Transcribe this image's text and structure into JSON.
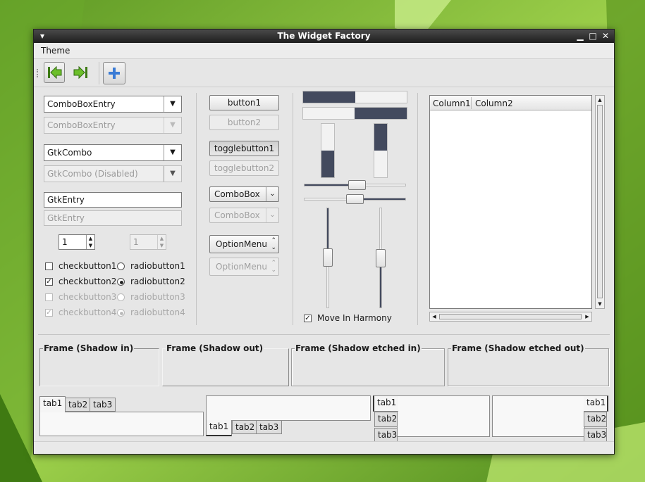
{
  "window": {
    "title": "The Widget Factory"
  },
  "menubar": {
    "theme": "Theme"
  },
  "left": {
    "combo_entry": "ComboBoxEntry",
    "combo_entry_dis": "ComboBoxEntry",
    "gtkcombo": "GtkCombo",
    "gtkcombo_dis": "GtkCombo (Disabled)",
    "entry": "GtkEntry",
    "entry_dis": "GtkEntry",
    "spin": "1",
    "spin_dis": "1",
    "check1": "checkbutton1",
    "check2": "checkbutton2",
    "check3": "checkbutton3",
    "check4": "checkbutton4",
    "radio1": "radiobutton1",
    "radio2": "radiobutton2",
    "radio3": "radiobutton3",
    "radio4": "radiobutton4"
  },
  "buttons": {
    "button1": "button1",
    "button2": "button2",
    "toggle1": "togglebutton1",
    "toggle2": "togglebutton2",
    "combobox": "ComboBox",
    "combobox_dis": "ComboBox",
    "optionmenu": "OptionMenu",
    "optionmenu_dis": "OptionMenu"
  },
  "sliders": {
    "harmony": "Move In Harmony"
  },
  "tree": {
    "columns": [
      "Column1",
      "Column2"
    ]
  },
  "frames": {
    "shadow_in": "Frame (Shadow in)",
    "shadow_out": "Frame (Shadow out)",
    "etched_in": "Frame (Shadow etched in)",
    "etched_out": "Frame (Shadow etched out)"
  },
  "tabs": {
    "t1": "tab1",
    "t2": "tab2",
    "t3": "tab3"
  },
  "icons": [
    "back-icon",
    "forward-icon",
    "add-icon",
    "minimize-icon",
    "maximize-icon",
    "close-icon",
    "window-menu-icon"
  ]
}
